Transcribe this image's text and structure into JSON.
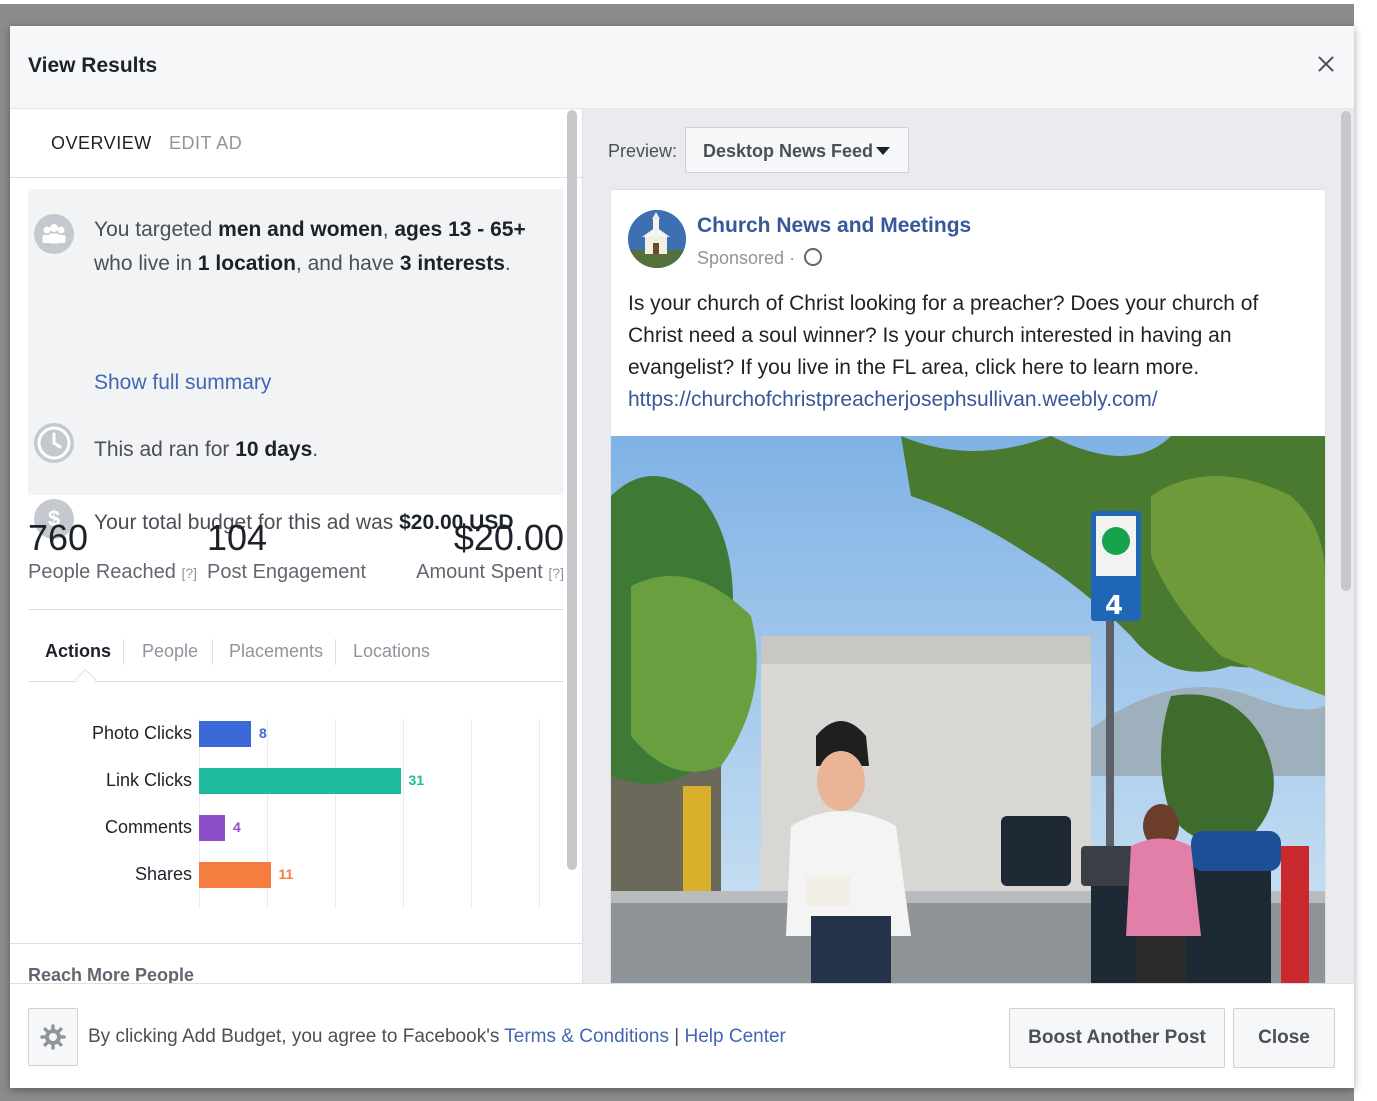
{
  "modal": {
    "title": "View Results",
    "close_icon": "close-icon"
  },
  "left": {
    "tabs": [
      {
        "label": "OVERVIEW",
        "active": true
      },
      {
        "label": "EDIT AD",
        "active": false
      }
    ],
    "summary": {
      "targeting": {
        "icon": "people-icon",
        "parts": [
          "You targeted ",
          "men and women",
          ", ",
          "ages 13 - 65+",
          " who live in ",
          "1 location",
          ", and have ",
          "3 interests",
          "."
        ]
      },
      "show_full_summary": "Show full summary",
      "duration": {
        "icon": "clock-icon",
        "parts": [
          "This ad ran for ",
          "10 days",
          "."
        ]
      },
      "budget": {
        "icon": "dollar-icon",
        "icon_glyph": "$",
        "parts": [
          "Your total budget for this ad was ",
          "$20.00 USD"
        ]
      }
    },
    "stats": [
      {
        "value": "760",
        "label": "People Reached",
        "help": "[?]"
      },
      {
        "value": "104",
        "label": "Post Engagement",
        "help": ""
      },
      {
        "value": "$20.00",
        "label": "Amount Spent",
        "help": "[?]"
      }
    ],
    "subtabs": [
      "Actions",
      "People",
      "Placements",
      "Locations"
    ],
    "active_subtab": "Actions",
    "reach_more_title": "Reach More People"
  },
  "chart_data": {
    "type": "bar",
    "orientation": "horizontal",
    "categories": [
      "Photo Clicks",
      "Link Clicks",
      "Comments",
      "Shares"
    ],
    "values": [
      8,
      31,
      4,
      11
    ],
    "colors": [
      "#3b69d8",
      "#1ebc9c",
      "#8c4fc7",
      "#f57d3f"
    ],
    "xlim": [
      0,
      52
    ],
    "grid": true
  },
  "right": {
    "preview_label": "Preview:",
    "preview_select": "Desktop News Feed",
    "post": {
      "page_name": "Church News and Meetings",
      "sponsored": "Sponsored · ",
      "body": "Is your church of Christ looking for a preacher? Does your church of Christ need a soul winner? Is your church interested in having an evangelist? If you live in the FL area, click here to learn more.",
      "link": "https://churchofchristpreacherjosephsullivan.weebly.com/",
      "sign_number": "4"
    }
  },
  "footer": {
    "gear_icon": "gear-icon",
    "agree_text": "By clicking Add Budget, you agree to Facebook's ",
    "terms_link": "Terms & Conditions",
    "separator": " | ",
    "help_link": "Help Center",
    "boost_button": "Boost Another Post",
    "close_button": "Close"
  }
}
